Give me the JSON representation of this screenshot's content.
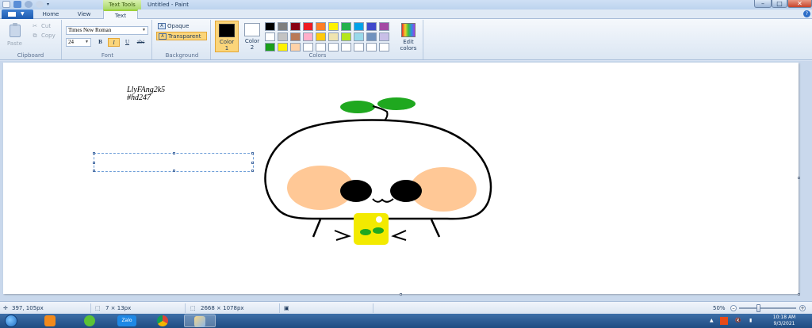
{
  "window": {
    "title": "Untitled - Paint",
    "context_tab": "Text Tools",
    "controls": {
      "minimize": "–",
      "maximize": "□",
      "close": "✕"
    }
  },
  "tabs": [
    {
      "label": "Home",
      "active": false
    },
    {
      "label": "View",
      "active": false
    },
    {
      "label": "Text",
      "active": true
    }
  ],
  "ribbon": {
    "clipboard": {
      "label": "Clipboard",
      "paste": "Paste",
      "cut": "Cut",
      "copy": "Copy"
    },
    "font": {
      "label": "Font",
      "family": "Times New Roman",
      "size": "24",
      "bold": "B",
      "italic": "I",
      "underline": "U",
      "strikethrough": "abc",
      "italic_active": true
    },
    "background": {
      "label": "Background",
      "opaque": "Opaque",
      "transparent": "Transparent",
      "selected": "Transparent"
    },
    "colors": {
      "label": "Colors",
      "color1_label": "Color",
      "color1_num": "1",
      "color2_label": "Color",
      "color2_num": "2",
      "color1_value": "#000000",
      "color2_value": "#ffffff",
      "edit_label": "Edit",
      "edit_label2": "colors",
      "palette": [
        "#000000",
        "#7f7f7f",
        "#880015",
        "#ed1c24",
        "#ff7f27",
        "#fff200",
        "#22b14c",
        "#00a2e8",
        "#3f48cc",
        "#a349a4",
        "#ffffff",
        "#c3c3c3",
        "#b97a57",
        "#ffaec9",
        "#ffc90e",
        "#efe4b0",
        "#b5e61d",
        "#99d9ea",
        "#7092be",
        "#c8bfe7",
        "#1b9e1b",
        "#fff200",
        "#ffd2a8",
        "#ffffff",
        "#ffffff",
        "#ffffff",
        "#ffffff",
        "#ffffff",
        "#ffffff",
        "#ffffff"
      ]
    }
  },
  "canvas": {
    "text_line1": "LlyFAng2k5",
    "text_line2": "#hd247"
  },
  "status": {
    "cursor_pos": "397, 105px",
    "selection_size": "7 × 13px",
    "image_size": "2668 × 1078px",
    "zoom": "50%"
  },
  "taskbar": {
    "apps": [
      "windows-media-icon",
      "app-icon",
      "zalo-icon",
      "chrome-icon",
      "paint-icon"
    ],
    "zalo_label": "Zalo",
    "clock_time": "10:18 AM",
    "clock_date": "9/3/2021"
  }
}
